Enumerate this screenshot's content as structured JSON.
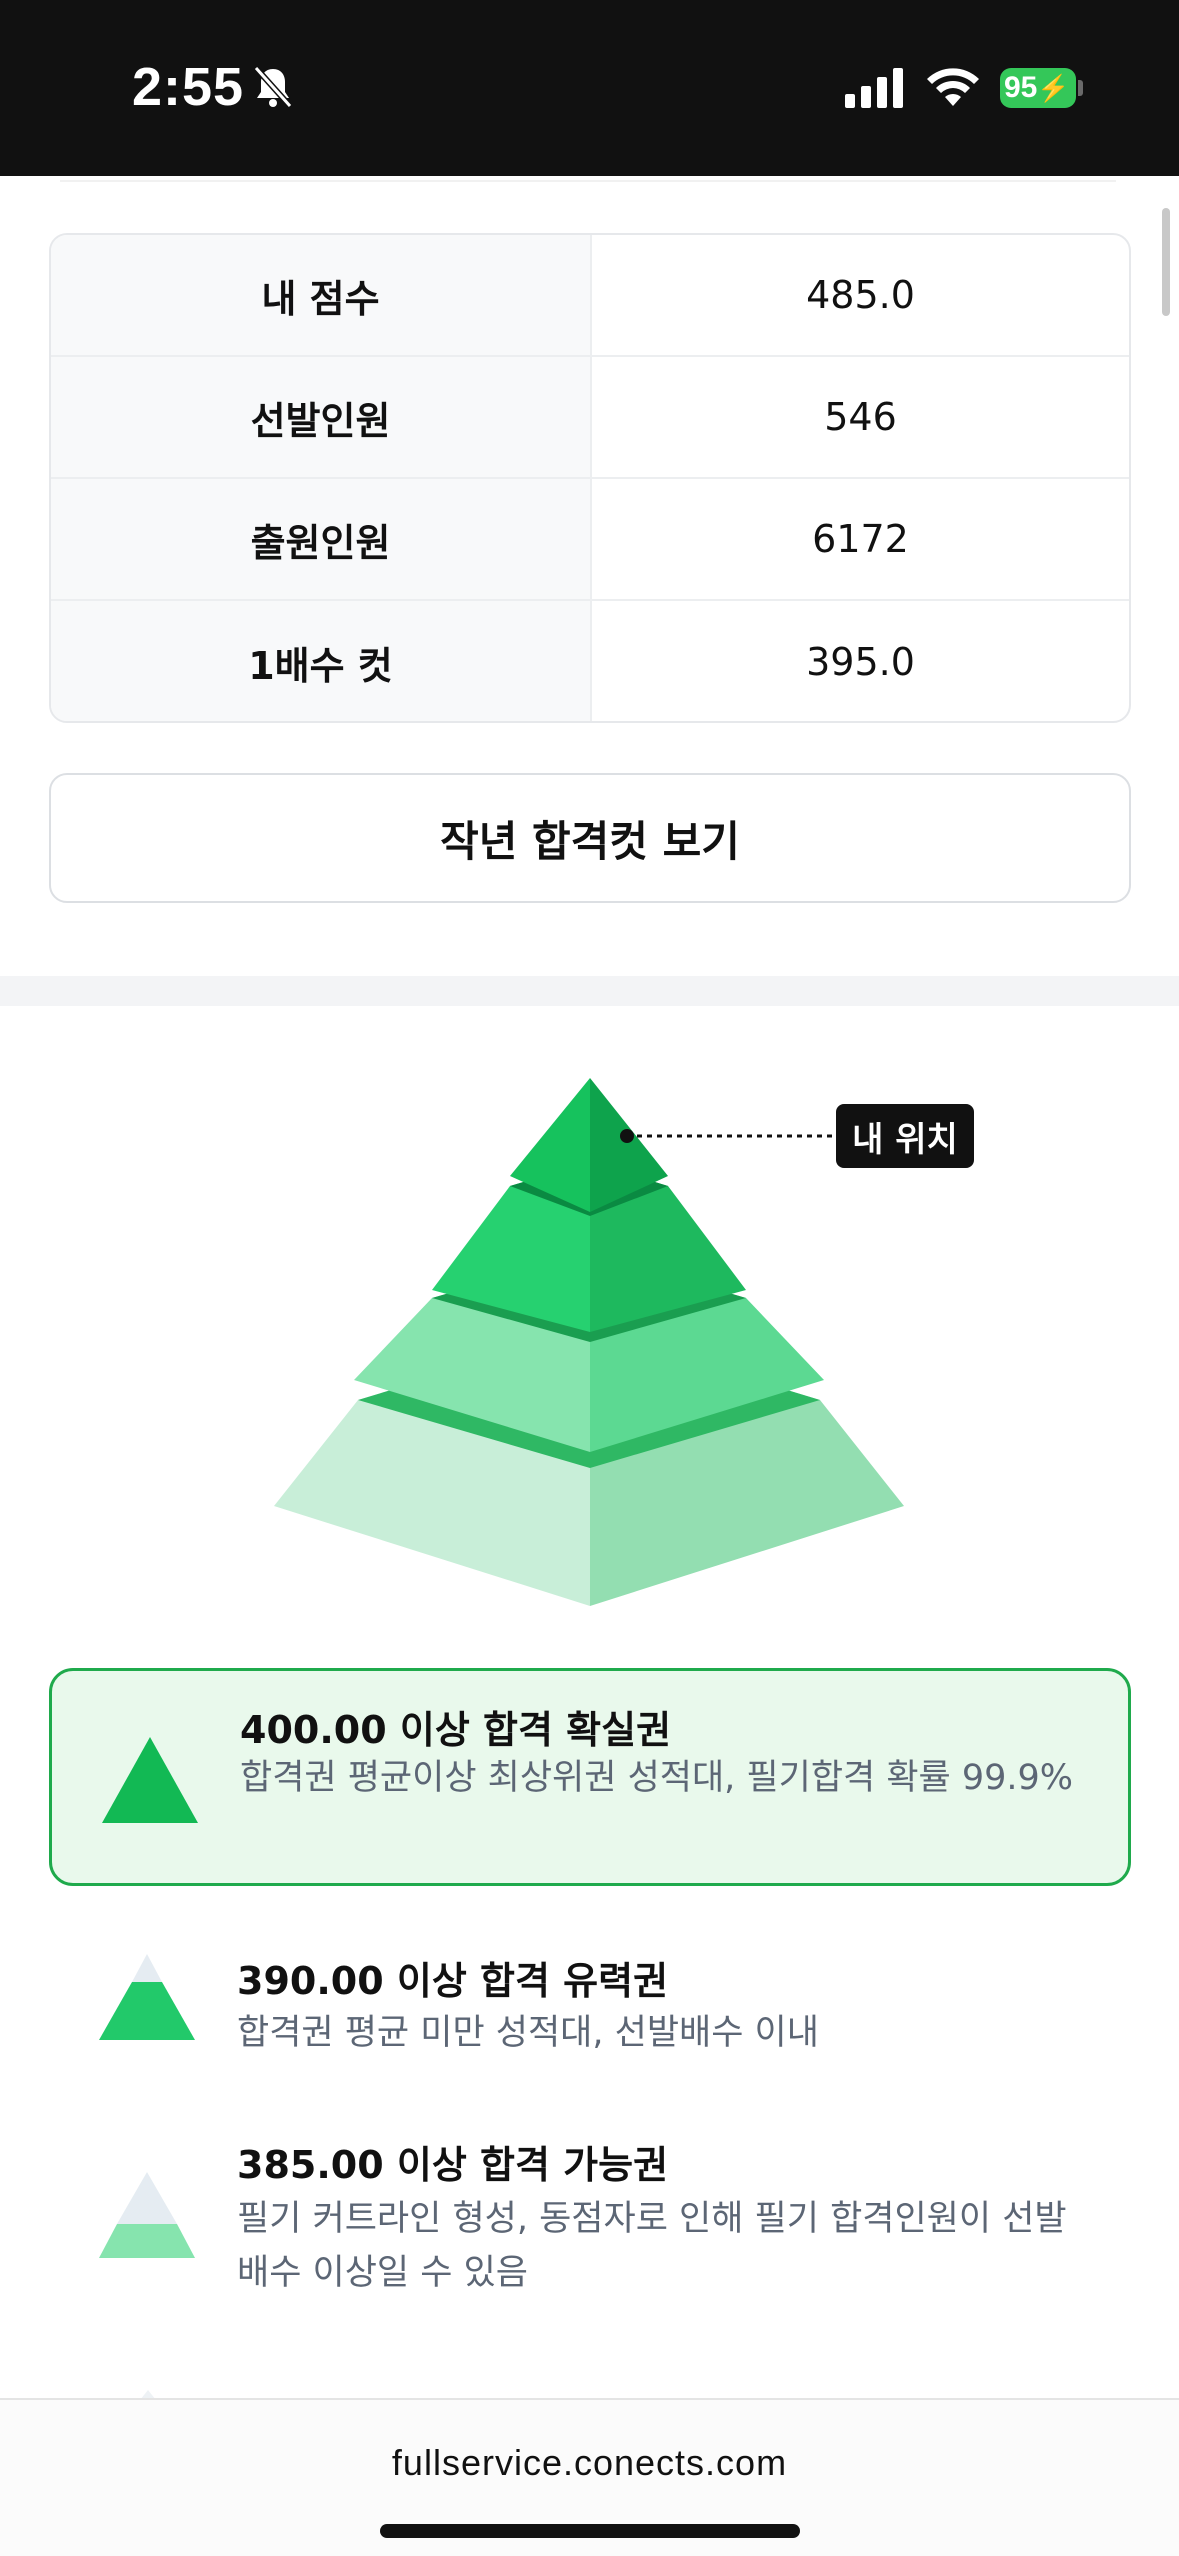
{
  "status_bar": {
    "time": "2:55",
    "battery": "95",
    "icons": [
      "bell-slash-icon",
      "cellular-signal-icon",
      "wifi-icon",
      "battery-charging-icon"
    ]
  },
  "stats": {
    "rows": [
      {
        "label": "내 점수",
        "value": "485.0"
      },
      {
        "label": "선발인원",
        "value": "546"
      },
      {
        "label": "출원인원",
        "value": "6172"
      },
      {
        "label": "1배수 컷",
        "value": "395.0"
      }
    ]
  },
  "last_year_button": "작년 합격컷 보기",
  "pyramid": {
    "my_position_label": "내 위치",
    "colors": {
      "top": "#12b954",
      "level2": "#22c96a",
      "level3": "#7ee0a4",
      "base": "#bfead1"
    }
  },
  "tiers": [
    {
      "title": "400.00 이상 합격 확실권",
      "desc": "합격권 평균이상 최상위권 성적대, 필기합격 확률 99.9%",
      "active": true
    },
    {
      "title": "390.00 이상 합격 유력권",
      "desc": "합격권 평균 미만 성적대, 선발배수 이내",
      "active": false
    },
    {
      "title": "385.00 이상 합격 가능권",
      "desc": "필기 커트라인 형성, 동점자로 인해 필기 합격인원이 선발배수 이상일 수 있음",
      "active": false
    }
  ],
  "url_bar": {
    "url": "fullservice.conects.com"
  }
}
